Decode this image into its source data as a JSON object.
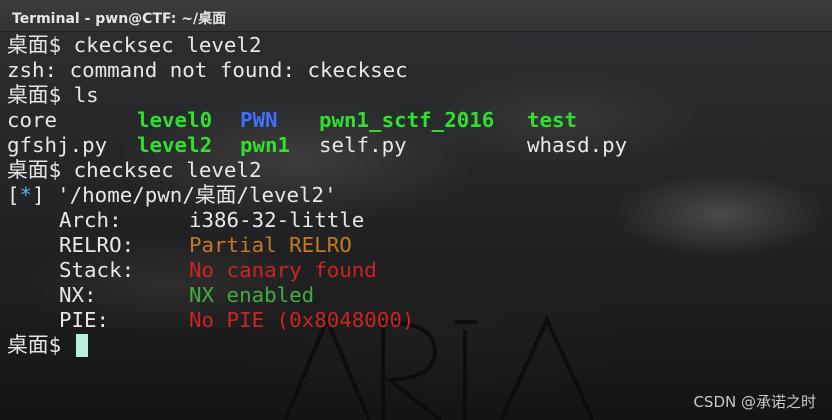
{
  "window": {
    "title": "Terminal - pwn@CTF: ~/桌面"
  },
  "prompt": {
    "dir": "桌面",
    "symbol": "$"
  },
  "lines": {
    "cmd1": "ckecksec level2",
    "err1": "zsh: command not found: ckecksec",
    "cmd2": "ls",
    "cmd3": "checksec level2",
    "info_marker": "*",
    "info_path": "'/home/pwn/桌面/level2'"
  },
  "ls_output": [
    [
      "core",
      "level0",
      "PWN",
      "pwn1_sctf_2016",
      "test"
    ],
    [
      "gfshj.py",
      "level2",
      "pwn1",
      "self.py",
      "whasd.py"
    ]
  ],
  "checksec": {
    "arch_key": "Arch:",
    "arch_val": "i386-32-little",
    "relro_key": "RELRO:",
    "relro_val": "Partial RELRO",
    "stack_key": "Stack:",
    "stack_val": "No canary found",
    "nx_key": "NX:",
    "nx_val": "NX enabled",
    "pie_key": "PIE:",
    "pie_val": "No PIE (0x8048000)"
  },
  "watermark": {
    "text": "CSDN @承诺之时"
  },
  "colors": {
    "background": "#1c1d1f",
    "titlebar": "#353638",
    "text": "#e8e8e8",
    "executable_green": "#2fe02f",
    "directory_blue": "#3f6fff",
    "info_blue": "#4fb6f0",
    "warn_orange": "#c47a21",
    "bad_red": "#cc2323",
    "good_green": "#3fae3f",
    "cursor": "#b8f0d8"
  }
}
